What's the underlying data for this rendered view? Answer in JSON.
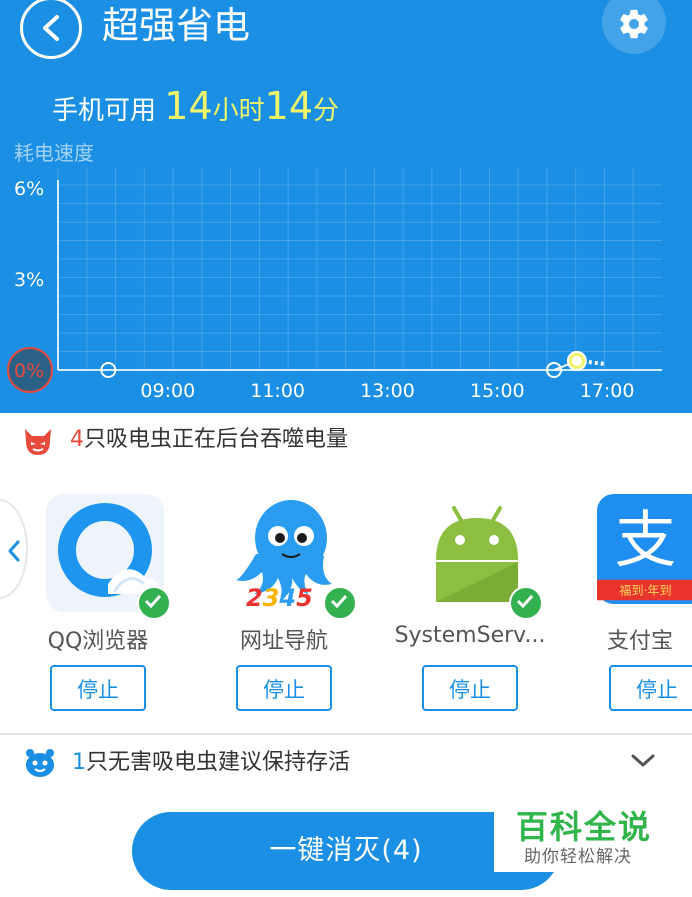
{
  "header": {
    "title": "超强省电",
    "back_icon": "chevron-left-icon",
    "settings_icon": "gear-icon"
  },
  "battery": {
    "prefix": "手机可用",
    "hours": "14",
    "hours_unit": "小时",
    "minutes": "14",
    "minutes_unit": "分"
  },
  "chart_data": {
    "type": "line",
    "ylabel": "耗电速度",
    "y_ticks": [
      "6%",
      "3%",
      "0%"
    ],
    "x_ticks": [
      "09:00",
      "11:00",
      "13:00",
      "15:00",
      "17:00"
    ],
    "ylim": [
      0,
      6
    ],
    "points": [
      {
        "x": "07:55",
        "y": 0
      },
      {
        "x": "16:02",
        "y": 0
      },
      {
        "x": "16:27",
        "y": 0.3
      }
    ],
    "projection_end": {
      "x": "16:58",
      "y": 0.2
    },
    "grid": true,
    "colors": {
      "line": "#ffffff",
      "highlight": "#f1f56a",
      "background": "#1a8fe3"
    }
  },
  "hazards": {
    "count": "4",
    "text": "只吸电虫正在后台吞噬电量",
    "icon": "devil-icon",
    "accent": "#e84a3c"
  },
  "apps": [
    {
      "name": "QQ浏览器",
      "stop_label": "停止",
      "checked": true,
      "icon": "qq-browser-icon"
    },
    {
      "name": "网址导航",
      "stop_label": "停止",
      "checked": true,
      "icon": "2345-octopus-icon",
      "icon_text": "2345"
    },
    {
      "name": "SystemServ...",
      "stop_label": "停止",
      "checked": true,
      "icon": "android-icon"
    },
    {
      "name": "支付宝",
      "stop_label": "停止",
      "checked": false,
      "icon": "alipay-icon",
      "icon_text": "支",
      "banner_text": "福到·年到"
    }
  ],
  "harmless": {
    "count": "1",
    "text": "只无害吸电虫建议保持存活",
    "icon": "friendly-bug-icon",
    "expand_icon": "chevron-down-icon"
  },
  "action": {
    "kill_label": "一键消灭(4)"
  },
  "watermark": {
    "title": "百科全说",
    "subtitle": "助你轻松解决"
  },
  "colors": {
    "primary": "#1a8fe3",
    "check": "#33b04f"
  }
}
